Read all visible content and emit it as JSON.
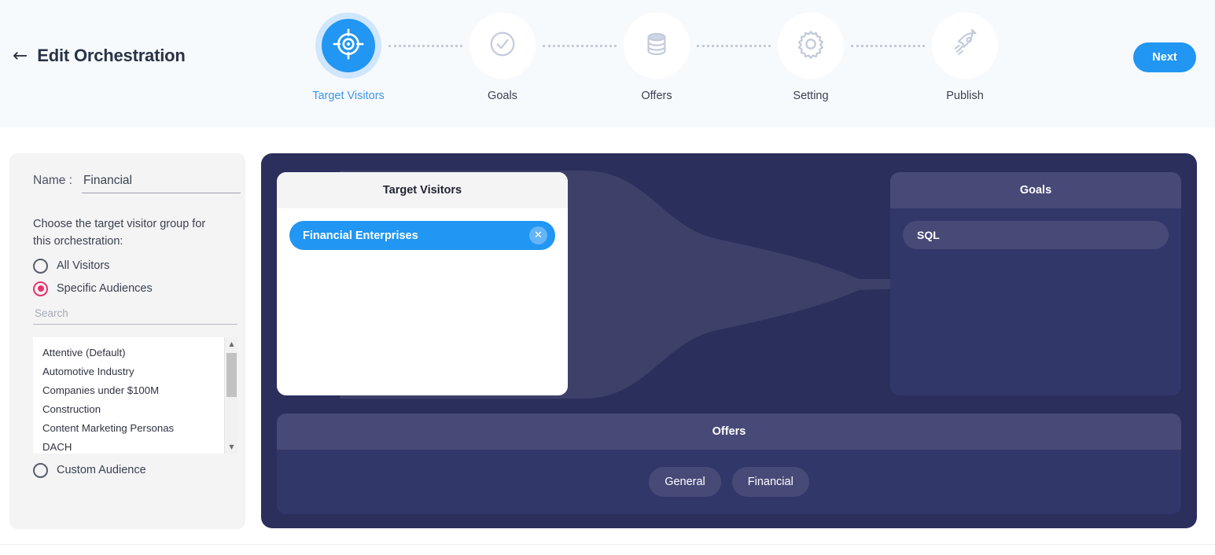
{
  "header": {
    "back_arrow": "←",
    "title": "Edit Orchestration",
    "next_label": "Next"
  },
  "stepper": {
    "steps": [
      {
        "label": "Target Visitors",
        "icon": "target-icon",
        "state": "active"
      },
      {
        "label": "Goals",
        "icon": "check-circle-icon",
        "state": "inactive"
      },
      {
        "label": "Offers",
        "icon": "database-icon",
        "state": "inactive"
      },
      {
        "label": "Setting",
        "icon": "gear-icon",
        "state": "inactive"
      },
      {
        "label": "Publish",
        "icon": "rocket-icon",
        "state": "inactive"
      }
    ]
  },
  "sidebar": {
    "name_label": "Name :",
    "name_value": "Financial",
    "choose_text": "Choose the target visitor group for this orchestration:",
    "options": [
      {
        "label": "All Visitors",
        "selected": false
      },
      {
        "label": "Specific Audiences",
        "selected": true
      },
      {
        "label": "Custom Audience",
        "selected": false
      }
    ],
    "search_placeholder": "Search",
    "search_value": "",
    "audiences": [
      "Attentive (Default)",
      "Automotive Industry",
      "Companies under $100M",
      "Construction",
      "Content Marketing Personas",
      "DACH"
    ]
  },
  "canvas": {
    "target_card": {
      "title": "Target Visitors",
      "chips": [
        {
          "label": "Financial Enterprises",
          "close_icon": "✕"
        }
      ]
    },
    "goals_card": {
      "title": "Goals",
      "items": [
        "SQL"
      ]
    },
    "offers_card": {
      "title": "Offers",
      "items": [
        "General",
        "Financial"
      ]
    }
  },
  "colors": {
    "accent_blue": "#2196f3",
    "accent_pink": "#e8336e",
    "canvas_dark": "#2b2f5c",
    "panel_purple": "#474a77",
    "funnel": "#3d4068"
  }
}
